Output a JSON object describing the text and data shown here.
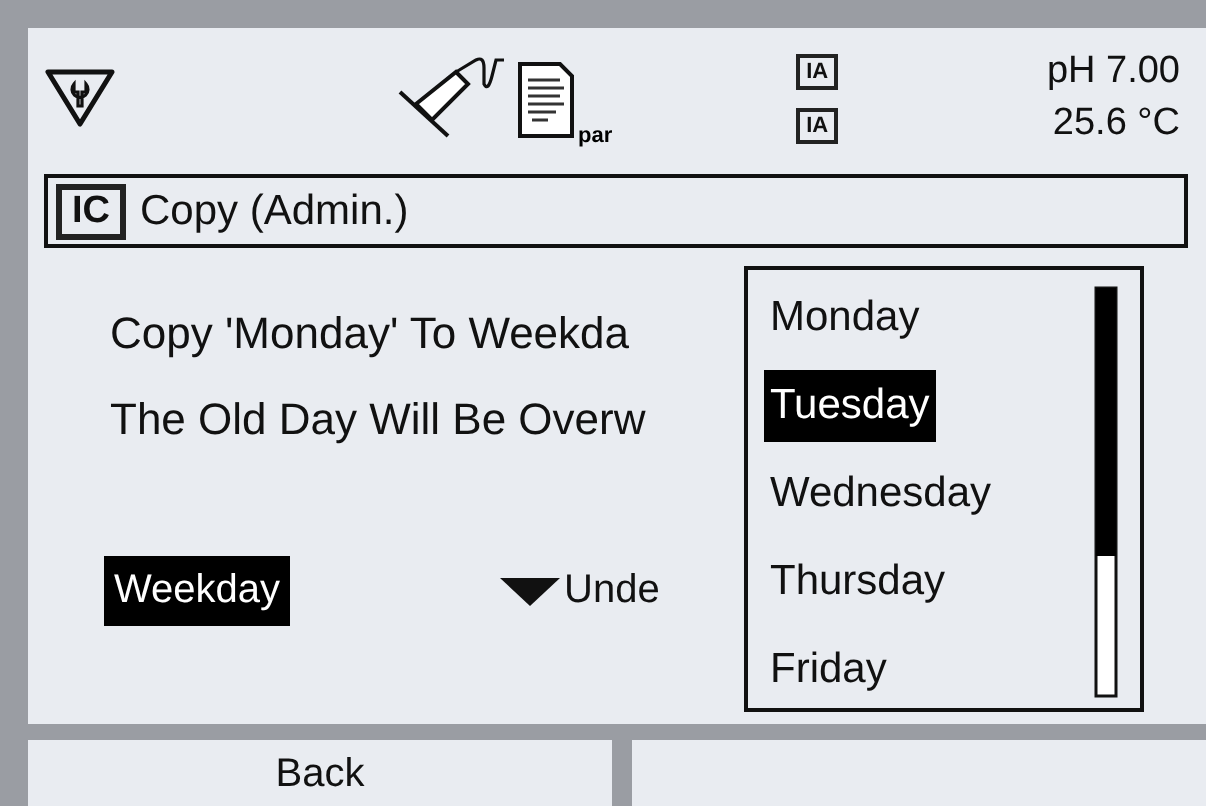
{
  "header": {
    "badges": [
      "IA",
      "IA"
    ],
    "doc_label": "par",
    "readings": [
      "pH 7.00",
      "25.6 °C"
    ]
  },
  "title_bar": {
    "badge": "IC",
    "title": "Copy (Admin.)"
  },
  "messages": [
    "Copy 'Monday' To Weekda",
    "The Old Day Will Be Overw"
  ],
  "selector": {
    "value": "Weekday",
    "target": "Unde"
  },
  "dropdown": {
    "items": [
      {
        "label": "Monday",
        "selected": false
      },
      {
        "label": "Tuesday",
        "selected": true
      },
      {
        "label": "Wednesday",
        "selected": false
      },
      {
        "label": "Thursday",
        "selected": false
      },
      {
        "label": "Friday",
        "selected": false
      }
    ]
  },
  "softkeys": [
    "Back"
  ]
}
